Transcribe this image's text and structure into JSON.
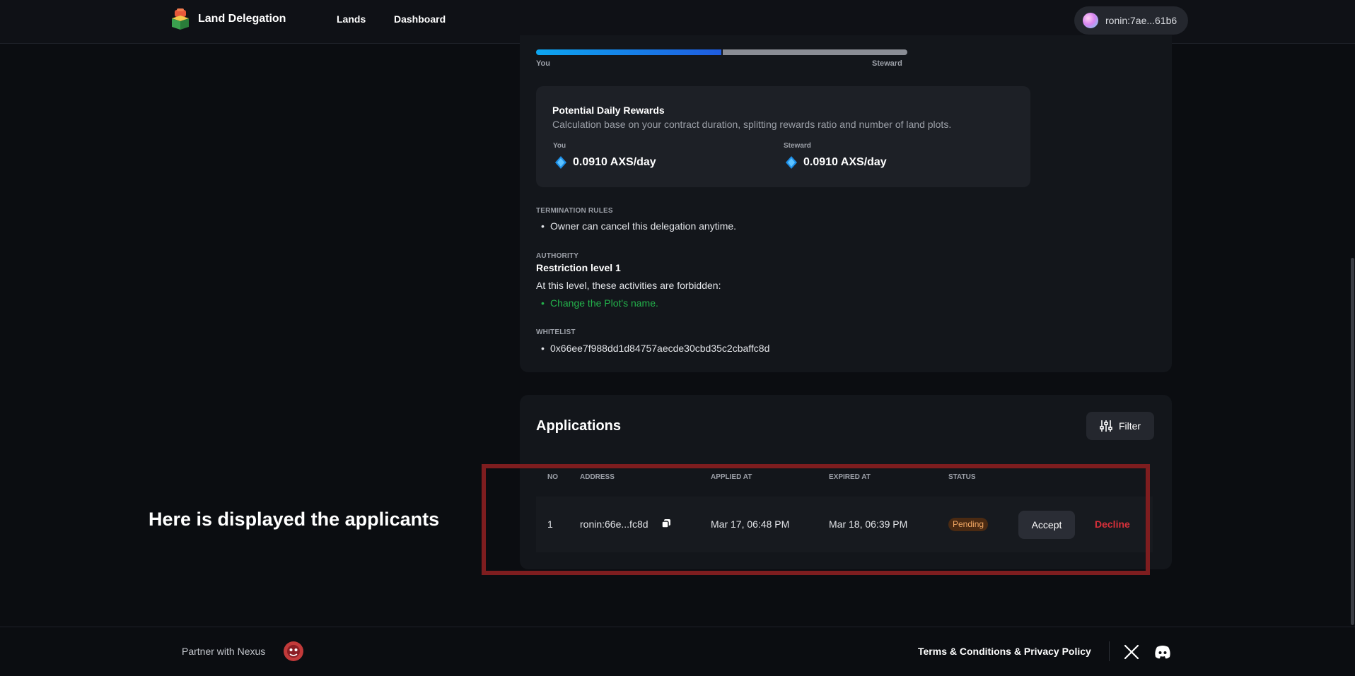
{
  "header": {
    "brand": "Land Delegation",
    "nav": [
      {
        "label": "Lands"
      },
      {
        "label": "Dashboard"
      }
    ],
    "wallet": "ronin:7ae...61b6"
  },
  "ratio": {
    "you_label": "You",
    "steward_label": "Steward",
    "you_share": 0.5
  },
  "rewards": {
    "title": "Potential Daily Rewards",
    "subtitle": "Calculation base on your contract duration, splitting rewards ratio and number of land plots.",
    "you_label": "You",
    "you_value": "0.0910 AXS/day",
    "steward_label": "Steward",
    "steward_value": "0.0910 AXS/day",
    "token_icon": "axs-token-icon"
  },
  "termination": {
    "label": "TERMINATION RULES",
    "items": [
      "Owner can cancel this delegation anytime."
    ]
  },
  "authority": {
    "label": "AUTHORITY",
    "level": "Restriction level 1",
    "description": "At this level, these activities are forbidden:",
    "items": [
      "Change the Plot's name."
    ],
    "item_color": "#23b24b"
  },
  "whitelist": {
    "label": "WHITELIST",
    "items": [
      "0x66ee7f988dd1d84757aecde30cbd35c2cbaffc8d"
    ]
  },
  "applications": {
    "title": "Applications",
    "filter_label": "Filter",
    "columns": [
      "NO",
      "ADDRESS",
      "APPLIED AT",
      "EXPIRED AT",
      "STATUS"
    ],
    "rows": [
      {
        "no": "1",
        "address": "ronin:66e...fc8d",
        "applied_at": "Mar 17, 06:48 PM",
        "expired_at": "Mar 18, 06:39 PM",
        "status": "Pending",
        "accept_label": "Accept",
        "decline_label": "Decline"
      }
    ]
  },
  "annotation": {
    "text": "Here is displayed the applicants",
    "color": "#7e1d1f"
  },
  "footer": {
    "partner": "Partner with Nexus",
    "terms": "Terms & Conditions & Privacy Policy"
  }
}
